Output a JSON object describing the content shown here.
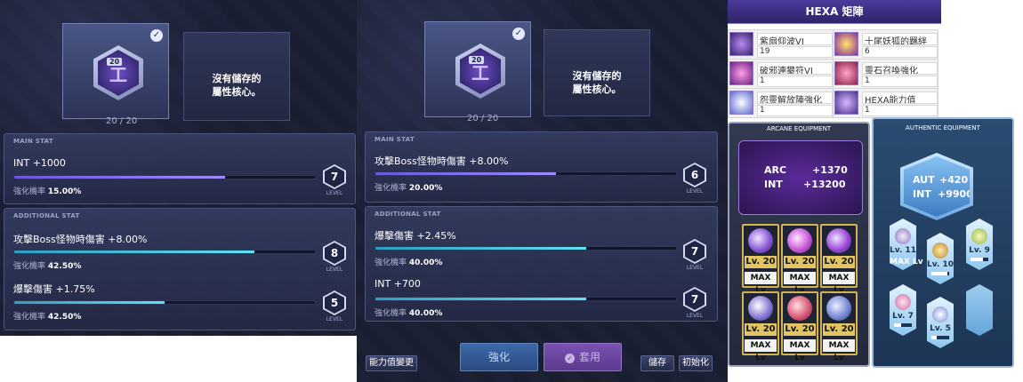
{
  "left_panel": {
    "core_count": "20 / 20",
    "core_level_tag": "20",
    "empty_slot_text": [
      "沒有儲存的",
      "屬性核心。"
    ],
    "main_stat": {
      "heading": "MAIN STAT",
      "text": "INT +1000",
      "rate_label": "強化機率",
      "rate_value": "15.00%",
      "level": "7",
      "level_word": "LEVEL",
      "progress": 0.7
    },
    "additional_stat": {
      "heading": "ADDITIONAL STAT",
      "rows": [
        {
          "text": "攻擊Boss怪物時傷害 +8.00%",
          "rate_label": "強化機率",
          "rate_value": "42.50%",
          "level": "8",
          "level_word": "LEVEL",
          "progress": 0.8
        },
        {
          "text": "爆擊傷害 +1.75%",
          "rate_label": "強化機率",
          "rate_value": "42.50%",
          "level": "5",
          "level_word": "LEVEL",
          "progress": 0.5
        }
      ]
    }
  },
  "right_panel": {
    "core_count": "20 / 20",
    "core_level_tag": "20",
    "empty_slot_text": [
      "沒有儲存的",
      "屬性核心。"
    ],
    "main_stat": {
      "heading": "MAIN STAT",
      "text": "攻擊Boss怪物時傷害 +8.00%",
      "rate_label": "強化機率",
      "rate_value": "20.00%",
      "level": "6",
      "level_word": "LEVEL",
      "progress": 0.6
    },
    "additional_stat": {
      "heading": "ADDITIONAL STAT",
      "rows": [
        {
          "text": "爆擊傷害 +2.45%",
          "rate_label": "強化機率",
          "rate_value": "40.00%",
          "level": "7",
          "level_word": "LEVEL",
          "progress": 0.7
        },
        {
          "text": "INT +700",
          "rate_label": "強化機率",
          "rate_value": "40.00%",
          "level": "7",
          "level_word": "LEVEL",
          "progress": 0.7
        }
      ]
    },
    "buttons": {
      "change_stat": "能力值變更",
      "enhance": "強化",
      "apply": "套用",
      "save": "儲存",
      "reset": "初始化"
    }
  },
  "hexa_matrix": {
    "title": "HEXA 矩陣",
    "skills": [
      {
        "name": "紫扇仰波VI",
        "level": "19"
      },
      {
        "name": "十尾妖狐的羈絆",
        "level": "6"
      },
      {
        "name": "破邪連攀符VI",
        "level": "1"
      },
      {
        "name": "靈石召喚強化",
        "level": "1"
      },
      {
        "name": "怨靈解放陣強化",
        "level": "1"
      },
      {
        "name": "HEXA能力值",
        "level": "1"
      }
    ]
  },
  "arcane_equipment": {
    "header": "ARCANE EQUIPMENT",
    "stats": [
      {
        "label": "ARC",
        "value": "+1370"
      },
      {
        "label": "INT",
        "value": "+13200"
      }
    ],
    "symbols": [
      {
        "level": "Lv. 20",
        "max": "MAX Lv"
      },
      {
        "level": "Lv. 20",
        "max": "MAX Lv"
      },
      {
        "level": "Lv. 20",
        "max": "MAX Lv"
      },
      {
        "level": "Lv. 20",
        "max": "MAX Lv"
      },
      {
        "level": "Lv. 20",
        "max": "MAX Lv"
      },
      {
        "level": "Lv. 20",
        "max": "MAX Lv"
      }
    ]
  },
  "authentic_equipment": {
    "header": "AUTHENTIC EQUIPMENT",
    "stats": [
      {
        "label": "AUT",
        "value": "+420"
      },
      {
        "label": "INT",
        "value": "+9900"
      }
    ],
    "symbols": [
      {
        "level": "Lv. 11",
        "max": "MAX Lv",
        "progress": 1.0
      },
      {
        "level": "Lv. 10",
        "max": "",
        "progress": 0.9
      },
      {
        "level": "Lv. 9",
        "max": "",
        "progress": 0.7
      },
      {
        "level": "Lv. 7",
        "max": "",
        "progress": 0.4
      },
      {
        "level": "Lv. 5",
        "max": "",
        "progress": 0.3
      }
    ]
  },
  "colors": {
    "panel_bg": "#1d2136",
    "bar_purple": "#8a78f0",
    "bar_cyan": "#4fcbe6",
    "enhance_button": "#3d68a8",
    "apply_button": "#7a52b2",
    "arcane_gold": "#d4b24c",
    "authentic_blue": "#2a4c72"
  }
}
